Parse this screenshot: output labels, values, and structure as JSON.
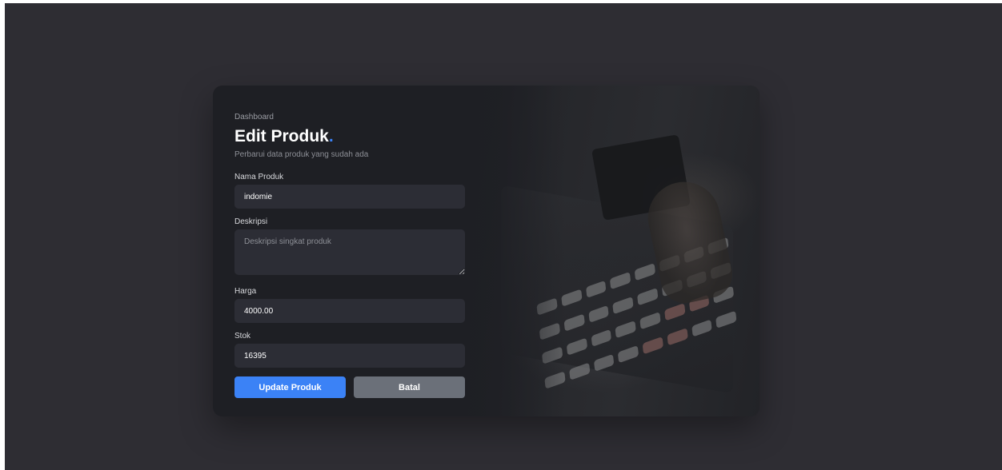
{
  "breadcrumb": "Dashboard",
  "title": "Edit Produk",
  "title_dot": ".",
  "subtitle": "Perbarui data produk yang sudah ada",
  "fields": {
    "nama": {
      "label": "Nama Produk",
      "value": "indomie",
      "placeholder": ""
    },
    "deskripsi": {
      "label": "Deskripsi",
      "value": "",
      "placeholder": "Deskripsi singkat produk"
    },
    "harga": {
      "label": "Harga",
      "value": "4000.00",
      "placeholder": ""
    },
    "stok": {
      "label": "Stok",
      "value": "16395",
      "placeholder": ""
    }
  },
  "buttons": {
    "update_label": "Update Produk",
    "cancel_label": "Batal"
  },
  "colors": {
    "accent": "#3b82f6",
    "secondary_button": "#6b7079",
    "background": "#2e2d33",
    "card": "#1e1f24",
    "input": "#2c2d35"
  },
  "illustration": "cash-register-photo"
}
